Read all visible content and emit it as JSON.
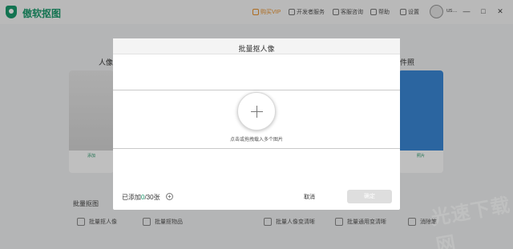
{
  "app": {
    "title": "傲软抠图"
  },
  "titlebar": {
    "vip": "购买VIP",
    "developer": "开发者服务",
    "support": "客服咨询",
    "help": "帮助",
    "settings": "设置",
    "user": "us..."
  },
  "background": {
    "left_label": "人像",
    "right_label": "件照",
    "left_caption": "添加",
    "right_caption": "照片",
    "section_title": "批量抠图",
    "tools": [
      "批量抠人像",
      "批量抠物品",
      "批量人像变清晰",
      "批量通用变清晰",
      "消除笔"
    ]
  },
  "modal": {
    "title": "批量抠人像",
    "drop_hint": "点击或拖拽载入多个图片",
    "added_prefix": "已添加",
    "added_count": "0",
    "added_suffix": "/30张",
    "add_more": "+",
    "cancel": "取消",
    "confirm": "确定"
  },
  "watermark": "光速下载网",
  "colors": {
    "accent": "#1a9a6c",
    "vip": "#e8912b"
  }
}
